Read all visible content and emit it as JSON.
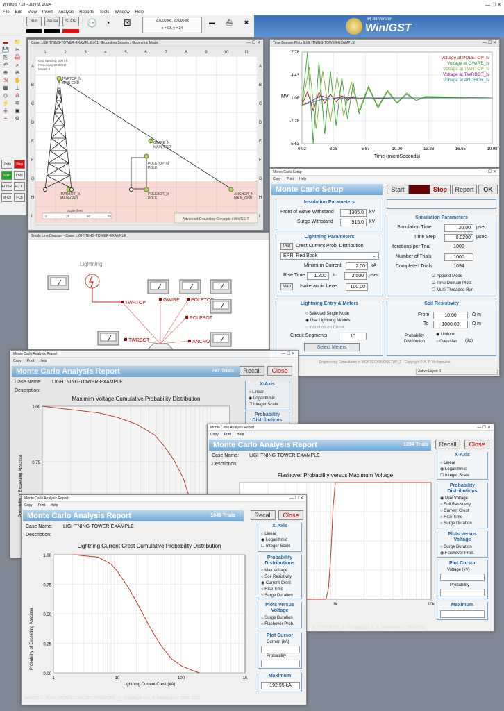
{
  "app": {
    "title": "WinIGS 7.0f - July 9, 2024",
    "menu": [
      "File",
      "Edit",
      "View",
      "Insert",
      "Analysis",
      "Reports",
      "Tools",
      "Window",
      "Help"
    ],
    "toolbar": {
      "run": "Run",
      "pause": "Pause",
      "stop": "STOP",
      "coord1": "20.000 xx , 20.000 xx",
      "coord2": "x = 93, y = 24",
      "brand_sub": "64 Bit Version",
      "brand": "WinIGST"
    },
    "left_tools": [
      "Undo",
      "Step",
      "Start",
      "OPF",
      "FLISR",
      "FLOC",
      "M-Ch",
      "I-Ch"
    ]
  },
  "geo": {
    "title": "Case: LIGHTNING-TOWER-EXAMPLE.001, Grounding System / Geometric Model",
    "info": [
      "Grid Spacing: 300 f-ft",
      "Frequency 60.00 Hz",
      "Model: 0"
    ],
    "col_ticks": [
      "1",
      "2",
      "3",
      "4",
      "5",
      "6",
      "7",
      "8",
      "9",
      "10",
      "11"
    ],
    "row_ticks": [
      "A",
      "B",
      "C",
      "D",
      "E",
      "F",
      "G",
      "H",
      "I"
    ],
    "nodes": [
      "TWRTOP_N\nMAIN-GND",
      "GWIRE_N\nMAIN-GND",
      "POLETOP_N\nPOLE",
      "TWRBOT_N\nMAIN-GND",
      "POLEBOT_N\nPOLE",
      "ANCHOR_N\nMAIN_GND"
    ],
    "scale": "Scale (feet)",
    "scale_ticks": [
      "0",
      "25",
      "50",
      "75"
    ],
    "footer": "Advanced Grounding Concepts / WinIGS-T"
  },
  "sld": {
    "title": "Single Line Diagram - Case: LIGHTNING-TOWER-EXAMPLE",
    "lightning": "Lightning",
    "labels": [
      "TWRTOP",
      "GWIRE",
      "POLETOP",
      "POLEBOT",
      "TWRBOT",
      "ANCHOR"
    ]
  },
  "tdp": {
    "title": "Time Domain Plots (LIGHTNING-TOWER-EXAMPLE)",
    "ylabel": "MV",
    "xlabel": "Time (microSeconds)",
    "yticks": [
      "7.78",
      "4.43",
      "1.08",
      "-2.28",
      "-5.63"
    ],
    "xticks": [
      "0.02",
      "3.35",
      "6.67",
      "10.00",
      "13.33",
      "16.65",
      "19.98"
    ],
    "legend": [
      {
        "name": "Voltage at POLETOP_N",
        "color": "#a01515"
      },
      {
        "name": "Voltage at GWIRE_N",
        "color": "#2f9e2f"
      },
      {
        "name": "Voltage at TWRTOP_N",
        "color": "#7da830"
      },
      {
        "name": "Voltage at TWRBOT_N",
        "color": "#a0159a"
      },
      {
        "name": "Voltage at ANCHOR_N",
        "color": "#2b9090"
      }
    ]
  },
  "mc": {
    "title": "Monte Carlo Setup",
    "wintitle": "Monte Carlo Setup",
    "menu": [
      "Copy",
      "Print",
      "Help"
    ],
    "buttons": {
      "start": "Start",
      "stop": "Stop",
      "report": "Report",
      "ok": "OK"
    },
    "insulation": {
      "title": "Insulation Parameters",
      "fow_label": "Front of Wave Withstand",
      "fow": "1395.0",
      "fow_unit": "kV",
      "surge_label": "Surge Withstand",
      "surge": "915.0",
      "surge_unit": "kV"
    },
    "lightning": {
      "title": "Lightning Parameters",
      "plot": "Plot",
      "dist_label": "Crest Current Prob. Distribution",
      "dist": "EPRI Red Book",
      "minc_label": "Minimum Current",
      "minc": "2.00",
      "minc_unit": "kA",
      "rise_label": "Rise Time",
      "rise_from": "1.200",
      "to": "to",
      "rise_to": "3.500",
      "rise_unit": "µsec",
      "map": "Map",
      "iso_label": "Isokeraunic Level",
      "iso": "100.00"
    },
    "entry": {
      "title": "Lightning Entry & Meters",
      "opt1": "Selected Single Node",
      "opt2": "Use Lightning Models",
      "opt3": "Induction on Circuit",
      "seg_label": "Circuit Segments",
      "seg": "10",
      "meters": "Select Meters"
    },
    "sim": {
      "title": "Simulation Parameters",
      "time_label": "Simulation Time",
      "time": "20.00",
      "time_unit": "µsec",
      "step_label": "Time Step",
      "step": "0.0200",
      "step_unit": "µsec",
      "ipt_label": "Iterations per Trial",
      "ipt": "1000",
      "trials_label": "Number of Trials",
      "trials": "1000",
      "comp_label": "Completed Trials",
      "comp": "1094",
      "c1": "Append Mode",
      "c2": "Time Domain Plots",
      "c3": "Multi-Threaded Run"
    },
    "soil": {
      "title": "Soil Resistivity",
      "from_label": "From",
      "from": "10.00",
      "to_label": "To",
      "to": "1000.00",
      "unit": "Ω m",
      "pd_label": "Probability\nDistribution",
      "u": "Uniform",
      "g": "Gaussian",
      "g2": "(3σ)"
    },
    "footer": "Engineering Consultants in MONTECARLOSETUP_2 - Copyright © A. P. Meliopoulos",
    "status": "Active Layer: 0"
  },
  "r1": {
    "wintitle": "Monte Carlo Analysis Report",
    "menu": [
      "Copy",
      "Print",
      "Help"
    ],
    "header": "Monte Carlo Analysis Report",
    "trials": "787 Trials",
    "recall": "Recall",
    "close": "Close",
    "case_label": "Case Name:",
    "case": "LIGHTNING-TOWER-EXAMPLE",
    "desc_label": "Description:",
    "chart_title": "Maximim Voltage Cumulative Probability Distribution",
    "ylabel": "Probability of Exceeding Abscissa",
    "yticks": [
      "1.00",
      "0.75",
      "0.50"
    ],
    "xaxis": "X-Axis",
    "x1": "Linear",
    "x2": "Logarithmic",
    "x3": "Integer Scale",
    "pd": "Probability\nDistributions"
  },
  "r2": {
    "wintitle": "Monte Carlo Analysis Report",
    "menu": [
      "Copy",
      "Print",
      "Help"
    ],
    "header": "Monte Carlo Analysis Report",
    "trials": "1094 Trials",
    "recall": "Recall",
    "close": "Close",
    "case_label": "Case Name:",
    "case": "LIGHTNING-TOWER-EXAMPLE",
    "desc_label": "Description:",
    "chart_title": "Flashover Probability versus Maximum Voltage",
    "xlabel": "Voltage (kV)",
    "xticks": [
      "1k",
      "10k"
    ],
    "xaxis": "X-Axis",
    "x1": "Linear",
    "x2": "Logarithmic",
    "x3": "Integer Scale",
    "pd": "Probability\nDistributions",
    "pd_opts": [
      "Max Voltage",
      "Soil Resistivity",
      "Current Crest",
      "Rise Time",
      "Surge Duration"
    ],
    "pv": "Plots versus\nVoltage",
    "pv_opts": [
      "Surge Duration",
      "Flashover Prob."
    ],
    "cursor": "Plot Cursor",
    "cv": "Voltage (kV)",
    "cp": "Probability",
    "max": "Maximum",
    "footer": "PLOTREPORT_2 - Copyright © A. P. Meliopoulos 1998-2022"
  },
  "r3": {
    "wintitle": "Monte Carlo Analysis Report",
    "menu": [
      "Copy",
      "Print",
      "Help"
    ],
    "header": "Monte Carlo Analysis Report",
    "trials": "1045 Trials",
    "recall": "Recall",
    "close": "Close",
    "case_label": "Case Name:",
    "case": "LIGHTNING-TOWER-EXAMPLE",
    "desc_label": "Description:",
    "chart_title": "Lightning Current Crest Cumulative Probability Distribution",
    "ylabel": "Probability of Exceeding Abscissa",
    "xlabel": "Lightning Current Crest (kA)",
    "yticks": [
      "1.00",
      "0.75",
      "0.50",
      "0.25",
      "0.00"
    ],
    "xticks": [
      "1",
      "10",
      "100",
      "1k"
    ],
    "xaxis": "X-Axis",
    "x1": "Linear",
    "x2": "Logarithmic",
    "x3": "Integer Scale",
    "pd": "Probability\nDistributions",
    "pd_opts": [
      "Max Voltage",
      "Soil Resistivity",
      "Current Crest",
      "Rise Time",
      "Surge Duration"
    ],
    "pv": "Plots versus\nVoltage",
    "pv_opts": [
      "Surge Duration",
      "Flashover Prob."
    ],
    "cursor": "Plot Cursor",
    "cc": "Current (kA)",
    "cp": "Probability",
    "max": "Maximum",
    "maxval": "192.95 kA",
    "footer": "WinIGS-T - Form: MONTECARLOPLOTREPORT_2 - Copyright © A. P. Meliopoulos 1998-2022"
  },
  "chart_data": [
    {
      "type": "line",
      "title": "",
      "ylabel": "MV",
      "xlabel": "Time (microSeconds)",
      "ylim": [
        -5.63,
        7.78
      ],
      "xlim": [
        0.02,
        19.98
      ],
      "series": [
        {
          "name": "Voltage at POLETOP_N",
          "x": [
            0.02,
            0.6,
            1.2,
            1.8,
            2.4,
            3.0,
            3.6,
            4.2,
            4.8,
            5.4,
            6.0,
            7.0,
            8.0,
            10,
            20
          ],
          "y": [
            0,
            2.0,
            -0.8,
            1.9,
            0.3,
            1.6,
            0.5,
            1.4,
            0.7,
            1.3,
            0.9,
            1.1,
            1.0,
            1.08,
            1.08
          ]
        },
        {
          "name": "Voltage at GWIRE_N",
          "x": [
            0.02,
            0.6,
            1.2,
            1.8,
            2.4,
            3.0,
            3.6,
            4.2,
            4.8,
            5.4,
            6.0,
            7.0,
            8.0,
            9.0,
            10,
            11,
            12,
            13,
            20
          ],
          "y": [
            0,
            7.78,
            -5.63,
            6.3,
            -4.2,
            5.0,
            -3.0,
            4.0,
            -2.0,
            3.2,
            -1.2,
            2.6,
            -0.4,
            2.0,
            0.3,
            1.6,
            0.7,
            1.2,
            1.08
          ]
        },
        {
          "name": "Voltage at TWRTOP_N",
          "x": [
            0.02,
            0.8,
            1.5,
            2.2,
            3.0,
            3.7,
            4.4,
            5.2,
            6.0,
            7.0,
            8.0,
            9.0,
            10,
            11,
            12,
            13,
            20
          ],
          "y": [
            0,
            5.6,
            -3.4,
            5.0,
            -2.4,
            4.2,
            -1.6,
            3.4,
            -0.8,
            2.8,
            -0.2,
            2.2,
            0.4,
            1.8,
            0.7,
            1.3,
            1.08
          ]
        },
        {
          "name": "Voltage at TWRBOT_N",
          "x": [
            0.02,
            1,
            2,
            3,
            4,
            6,
            8,
            20
          ],
          "y": [
            0,
            0.6,
            1.4,
            0.9,
            1.2,
            1.05,
            1.08,
            1.08
          ]
        },
        {
          "name": "Voltage at ANCHOR_N",
          "x": [
            0.02,
            2,
            4,
            6,
            20
          ],
          "y": [
            0,
            0.8,
            1.0,
            1.05,
            1.08
          ]
        }
      ]
    },
    {
      "type": "line",
      "title": "Maximim Voltage Cumulative Probability Distribution",
      "ylabel": "Probability of Exceeding Abscissa",
      "ylim": [
        0.5,
        1.0
      ],
      "series": [
        {
          "name": "",
          "x": [
            0,
            0.1,
            0.2,
            0.3,
            0.4,
            0.5,
            0.6,
            0.65,
            0.7,
            0.75,
            0.8
          ],
          "y": [
            1.0,
            0.99,
            0.98,
            0.97,
            0.95,
            0.92,
            0.87,
            0.82,
            0.76,
            0.68,
            0.55
          ]
        }
      ]
    },
    {
      "type": "line",
      "title": "Flashover Probability versus Maximum Voltage",
      "xlabel": "Voltage (kV)",
      "log_x": true,
      "series": [
        {
          "name": "",
          "x": [
            100,
            800,
            850,
            900,
            950,
            1000,
            1500,
            10000
          ],
          "y": [
            0,
            0,
            0.1,
            0.4,
            0.8,
            1.0,
            1.0,
            1.0
          ]
        }
      ]
    },
    {
      "type": "line",
      "title": "Lightning Current Crest Cumulative Probability Distribution",
      "xlabel": "Lightning Current Crest (kA)",
      "ylabel": "Probability of Exceeding Abscissa",
      "log_x": true,
      "ylim": [
        0,
        1
      ],
      "xlim": [
        1,
        1000
      ],
      "series": [
        {
          "name": "",
          "x": [
            2,
            5,
            8,
            10,
            15,
            20,
            30,
            40,
            50,
            70,
            100,
            150,
            192.95
          ],
          "y": [
            1.0,
            0.98,
            0.92,
            0.86,
            0.72,
            0.6,
            0.42,
            0.3,
            0.22,
            0.12,
            0.06,
            0.02,
            0.0
          ]
        }
      ]
    }
  ]
}
